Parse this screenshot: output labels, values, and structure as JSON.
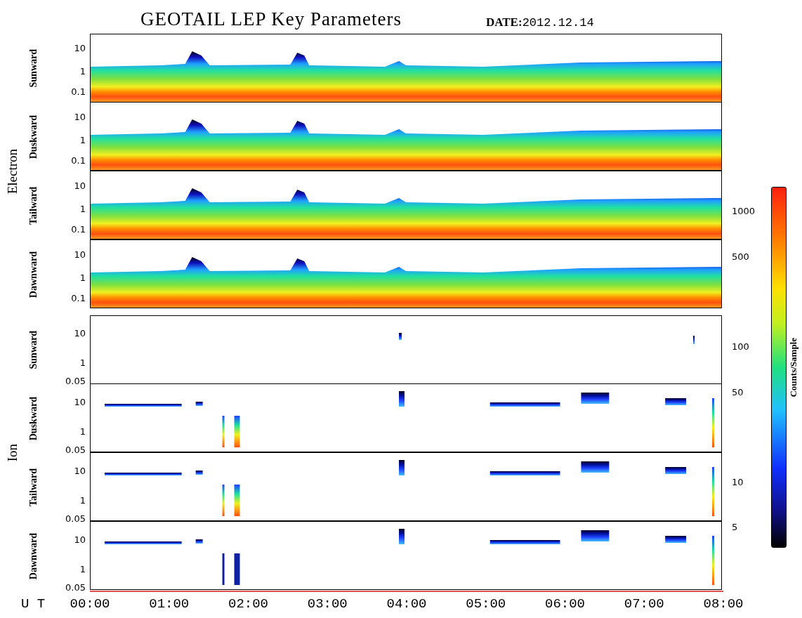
{
  "title": "GEOTAIL LEP Key Parameters",
  "date": "**DATE:**2012.12.14",
  "groups": [
    {
      "name": "Electron",
      "kind": "electron",
      "panels": [
        {
          "label": "Sunward",
          "yticks": [
            "10",
            "1",
            "0.1"
          ]
        },
        {
          "label": "Duskward",
          "yticks": [
            "10",
            "1",
            "0.1"
          ]
        },
        {
          "label": "Tailward",
          "yticks": [
            "10",
            "1",
            "0.1"
          ]
        },
        {
          "label": "Dawnward",
          "yticks": [
            "10",
            "1",
            "0.1"
          ]
        }
      ]
    },
    {
      "name": "Ion",
      "kind": "ion",
      "panels": [
        {
          "label": "Sunward",
          "yticks": [
            "10",
            "1",
            "0.05"
          ]
        },
        {
          "label": "Duskward",
          "yticks": [
            "10",
            "1",
            "0.05"
          ]
        },
        {
          "label": "Tailward",
          "yticks": [
            "10",
            "1",
            "0.05"
          ]
        },
        {
          "label": "Dawnward",
          "yticks": [
            "10",
            "1",
            "0.05"
          ]
        }
      ]
    }
  ],
  "x_axis": {
    "label": "U T",
    "ticks": [
      "00:00",
      "01:00",
      "02:00",
      "03:00",
      "04:00",
      "05:00",
      "06:00",
      "07:00",
      "08:00"
    ]
  },
  "colorbar": {
    "label": "Counts/Sample",
    "ticks": [
      "1000",
      "500",
      "100",
      "50",
      "10",
      "5"
    ]
  }
}
